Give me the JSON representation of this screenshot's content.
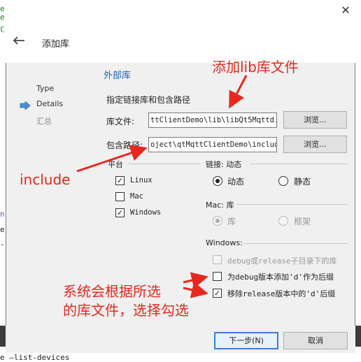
{
  "background": {
    "left_fragments": [
      "e",
      "e",
      "ℂ",
      "n",
      "e",
      "-"
    ],
    "bottom_text": "e —list-devices"
  },
  "dialog": {
    "title": "添加库",
    "close_symbol": "✕"
  },
  "steps": [
    {
      "label": "Type"
    },
    {
      "label": "Details"
    },
    {
      "label": "汇总"
    }
  ],
  "section": {
    "title": "外部库",
    "description": "指定链接库和包含路径"
  },
  "lib_file": {
    "label": "库文件:",
    "value": "ttClientDemo\\lib\\libQt5Mqttd.a",
    "browse_label": "浏览..."
  },
  "include_path": {
    "label": "包含路径:",
    "value": "oject\\qtMqttClientDemo\\include",
    "browse_label": "浏览..."
  },
  "platform": {
    "title": "平台",
    "options": [
      {
        "label": "Linux",
        "checked": true
      },
      {
        "label": "Mac",
        "checked": false
      },
      {
        "label": "Windows",
        "checked": true
      }
    ]
  },
  "linkage": {
    "title": "链接: 动态",
    "options": [
      {
        "label": "动态",
        "selected": true
      },
      {
        "label": "静态",
        "selected": false
      }
    ]
  },
  "mac": {
    "title": "Mac: 库",
    "options": [
      {
        "label": "库",
        "selected": true
      },
      {
        "label": "框架",
        "selected": false
      }
    ]
  },
  "windows": {
    "title": "Windows:",
    "options": [
      {
        "label": "debug或release子目录下的库",
        "checked": false,
        "disabled": true
      },
      {
        "label": "为debug版本添加'd'作为后缀",
        "checked": false,
        "disabled": false
      },
      {
        "label": "移除release版本中的'd'后缀",
        "checked": true,
        "disabled": false
      }
    ]
  },
  "buttons": {
    "next": "下一步(N)",
    "cancel": "取消"
  },
  "annotations": {
    "lib": "添加lib库文件",
    "include": "include",
    "system_line1": "系统会根据所选",
    "system_line2": "的库文件，选择勾选",
    "color": "#e8281e"
  }
}
